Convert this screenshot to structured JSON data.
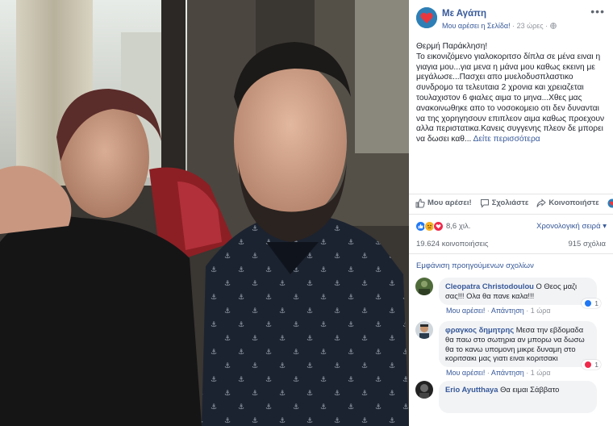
{
  "post": {
    "page_name": "Με Αγάπη",
    "liked_page": "Μου αρέσει η Σελίδα!",
    "time": "23 ώρες",
    "text_lines": [
      "Θερμή Παράκληση!",
      "Το εικονιζόμενο γιαλοκοριτσο δίπλα σε μένα ειναι η γιαγια μου...για μενα η μάνα μου καθως εκεινη με μεγάλωσε...Πασχει απο μυελοδυσπλαστικο συνδρομο τα τελευταια 2 χρονια και χρειαζεται τουλαχιστον 6 φιαλες αιμα το μηνα...Χθες μας ανακοινωθηκε απο το νοσοκομειο οτι δεν δυνανται να της χορηγησουν επιπλεον αιμα καθως προεχουν αλλα περιστατικα.Κανεις συγγενης πλεον δε μπορει να δωσει καθ..."
    ],
    "see_more": "Δείτε περισσότερα"
  },
  "actions": {
    "like": "Μου αρέσει!",
    "comment": "Σχολιάστε",
    "share": "Κοινοποιήστε"
  },
  "reactions": {
    "count": "8,6 χιλ.",
    "order": "Χρονολογική σειρά",
    "shares": "19.624 κοινοποιήσεις",
    "comments": "915 σχόλια"
  },
  "prev_comments": "Εμφάνιση προηγούμενων σχολίων",
  "comments": [
    {
      "name": "Cleopatra Christodoulou",
      "text": "Ο Θεος μαζι σας!!! Ολα θα πανε καλα!!!",
      "like": "Μου αρέσει!",
      "reply": "Απάντηση",
      "time": "1 ώρα",
      "react_count": "1"
    },
    {
      "name": "φραγκος δημητρης",
      "text": "Μεσα την εβδομαδα θα παω στο σωτηρια αν μπορω να δωσω θα το κανω υπομονη μικρε δυναμη στο κοριτσακι μας γιατι ειναι κοριτσακι",
      "like": "Μου αρέσει!",
      "reply": "Απάντηση",
      "time": "1 ώρα",
      "react_count": "1"
    },
    {
      "name": "Erio Ayutthaya",
      "text": "Θα ειμαι Σάββατο"
    }
  ],
  "colors": {
    "link": "#365899",
    "muted": "#90949c",
    "like_blue": "#2078f4",
    "heart_red": "#f0284a",
    "haha_yellow": "#f7b125"
  }
}
